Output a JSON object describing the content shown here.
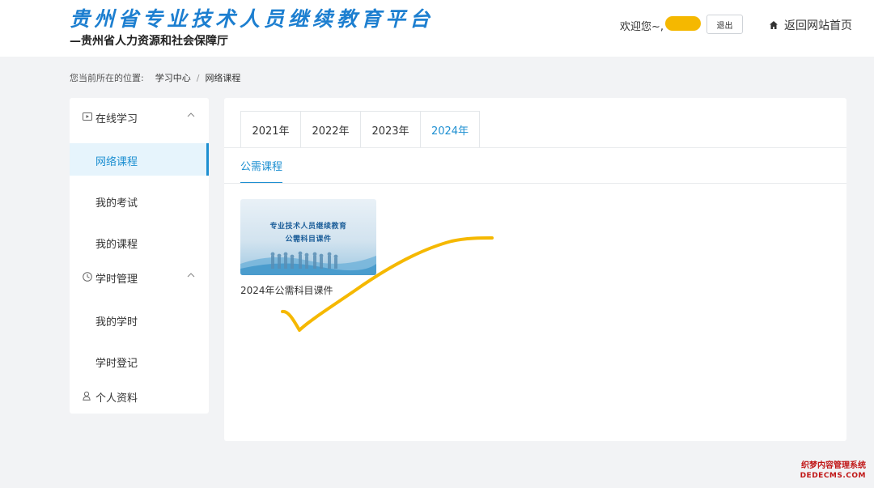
{
  "header": {
    "site_title": "贵州省专业技术人员继续教育平台",
    "site_subtitle": "—贵州省人力资源和社会保障厅",
    "welcome_text": "欢迎您~,",
    "logout_label": "退出",
    "home_label": "返回网站首页",
    "home_icon": "home-icon"
  },
  "breadcrumb": {
    "label": "您当前所在的位置:",
    "items": [
      "学习中心",
      "网络课程"
    ],
    "separator": "/"
  },
  "sidebar": {
    "groups": [
      {
        "label": "在线学习",
        "icon": "play-icon",
        "items": [
          {
            "label": "网络课程",
            "active": true
          },
          {
            "label": "我的考试",
            "active": false
          },
          {
            "label": "我的课程",
            "active": false
          }
        ]
      },
      {
        "label": "学时管理",
        "icon": "clock-icon",
        "items": [
          {
            "label": "我的学时",
            "active": false
          },
          {
            "label": "学时登记",
            "active": false
          }
        ]
      }
    ],
    "profile": {
      "label": "个人资料",
      "icon": "user-icon"
    }
  },
  "main": {
    "year_tabs": [
      "2021年",
      "2022年",
      "2023年",
      "2024年"
    ],
    "active_year": "2024年",
    "sub_tab": "公需课程",
    "courses": [
      {
        "thumbnail_line1": "专业技术人员继续教育",
        "thumbnail_line2": "公需科目课件",
        "title": "2024年公需科目课件"
      }
    ]
  },
  "watermark": {
    "line1": "织梦内容管理系统",
    "line2": "DEDECMS.COM"
  },
  "colors": {
    "accent": "#1d8fd1",
    "title_blue": "#1d7fd0",
    "annotation_yellow": "#f5b800",
    "background": "#f2f3f5"
  }
}
